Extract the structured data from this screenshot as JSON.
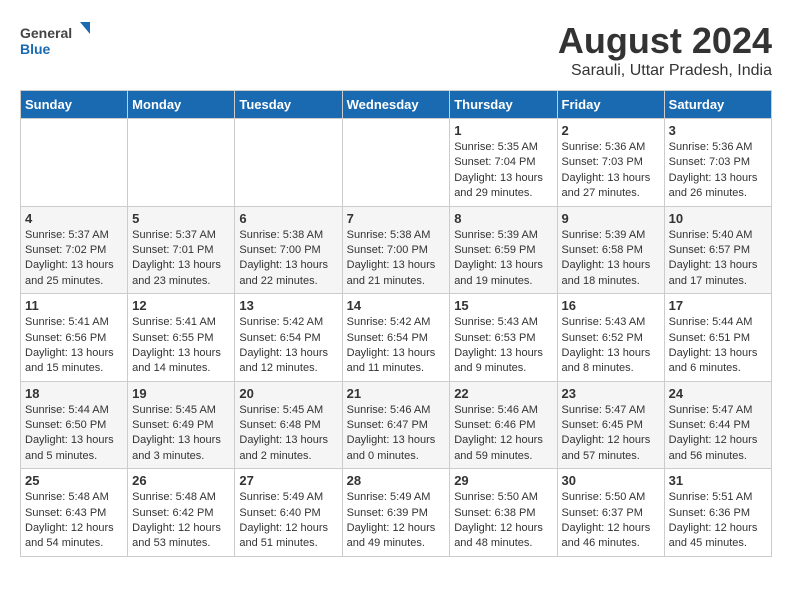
{
  "header": {
    "logo_general": "General",
    "logo_blue": "Blue",
    "month_year": "August 2024",
    "location": "Sarauli, Uttar Pradesh, India"
  },
  "days_of_week": [
    "Sunday",
    "Monday",
    "Tuesday",
    "Wednesday",
    "Thursday",
    "Friday",
    "Saturday"
  ],
  "weeks": [
    [
      {
        "day": "",
        "detail": ""
      },
      {
        "day": "",
        "detail": ""
      },
      {
        "day": "",
        "detail": ""
      },
      {
        "day": "",
        "detail": ""
      },
      {
        "day": "1",
        "detail": "Sunrise: 5:35 AM\nSunset: 7:04 PM\nDaylight: 13 hours\nand 29 minutes."
      },
      {
        "day": "2",
        "detail": "Sunrise: 5:36 AM\nSunset: 7:03 PM\nDaylight: 13 hours\nand 27 minutes."
      },
      {
        "day": "3",
        "detail": "Sunrise: 5:36 AM\nSunset: 7:03 PM\nDaylight: 13 hours\nand 26 minutes."
      }
    ],
    [
      {
        "day": "4",
        "detail": "Sunrise: 5:37 AM\nSunset: 7:02 PM\nDaylight: 13 hours\nand 25 minutes."
      },
      {
        "day": "5",
        "detail": "Sunrise: 5:37 AM\nSunset: 7:01 PM\nDaylight: 13 hours\nand 23 minutes."
      },
      {
        "day": "6",
        "detail": "Sunrise: 5:38 AM\nSunset: 7:00 PM\nDaylight: 13 hours\nand 22 minutes."
      },
      {
        "day": "7",
        "detail": "Sunrise: 5:38 AM\nSunset: 7:00 PM\nDaylight: 13 hours\nand 21 minutes."
      },
      {
        "day": "8",
        "detail": "Sunrise: 5:39 AM\nSunset: 6:59 PM\nDaylight: 13 hours\nand 19 minutes."
      },
      {
        "day": "9",
        "detail": "Sunrise: 5:39 AM\nSunset: 6:58 PM\nDaylight: 13 hours\nand 18 minutes."
      },
      {
        "day": "10",
        "detail": "Sunrise: 5:40 AM\nSunset: 6:57 PM\nDaylight: 13 hours\nand 17 minutes."
      }
    ],
    [
      {
        "day": "11",
        "detail": "Sunrise: 5:41 AM\nSunset: 6:56 PM\nDaylight: 13 hours\nand 15 minutes."
      },
      {
        "day": "12",
        "detail": "Sunrise: 5:41 AM\nSunset: 6:55 PM\nDaylight: 13 hours\nand 14 minutes."
      },
      {
        "day": "13",
        "detail": "Sunrise: 5:42 AM\nSunset: 6:54 PM\nDaylight: 13 hours\nand 12 minutes."
      },
      {
        "day": "14",
        "detail": "Sunrise: 5:42 AM\nSunset: 6:54 PM\nDaylight: 13 hours\nand 11 minutes."
      },
      {
        "day": "15",
        "detail": "Sunrise: 5:43 AM\nSunset: 6:53 PM\nDaylight: 13 hours\nand 9 minutes."
      },
      {
        "day": "16",
        "detail": "Sunrise: 5:43 AM\nSunset: 6:52 PM\nDaylight: 13 hours\nand 8 minutes."
      },
      {
        "day": "17",
        "detail": "Sunrise: 5:44 AM\nSunset: 6:51 PM\nDaylight: 13 hours\nand 6 minutes."
      }
    ],
    [
      {
        "day": "18",
        "detail": "Sunrise: 5:44 AM\nSunset: 6:50 PM\nDaylight: 13 hours\nand 5 minutes."
      },
      {
        "day": "19",
        "detail": "Sunrise: 5:45 AM\nSunset: 6:49 PM\nDaylight: 13 hours\nand 3 minutes."
      },
      {
        "day": "20",
        "detail": "Sunrise: 5:45 AM\nSunset: 6:48 PM\nDaylight: 13 hours\nand 2 minutes."
      },
      {
        "day": "21",
        "detail": "Sunrise: 5:46 AM\nSunset: 6:47 PM\nDaylight: 13 hours\nand 0 minutes."
      },
      {
        "day": "22",
        "detail": "Sunrise: 5:46 AM\nSunset: 6:46 PM\nDaylight: 12 hours\nand 59 minutes."
      },
      {
        "day": "23",
        "detail": "Sunrise: 5:47 AM\nSunset: 6:45 PM\nDaylight: 12 hours\nand 57 minutes."
      },
      {
        "day": "24",
        "detail": "Sunrise: 5:47 AM\nSunset: 6:44 PM\nDaylight: 12 hours\nand 56 minutes."
      }
    ],
    [
      {
        "day": "25",
        "detail": "Sunrise: 5:48 AM\nSunset: 6:43 PM\nDaylight: 12 hours\nand 54 minutes."
      },
      {
        "day": "26",
        "detail": "Sunrise: 5:48 AM\nSunset: 6:42 PM\nDaylight: 12 hours\nand 53 minutes."
      },
      {
        "day": "27",
        "detail": "Sunrise: 5:49 AM\nSunset: 6:40 PM\nDaylight: 12 hours\nand 51 minutes."
      },
      {
        "day": "28",
        "detail": "Sunrise: 5:49 AM\nSunset: 6:39 PM\nDaylight: 12 hours\nand 49 minutes."
      },
      {
        "day": "29",
        "detail": "Sunrise: 5:50 AM\nSunset: 6:38 PM\nDaylight: 12 hours\nand 48 minutes."
      },
      {
        "day": "30",
        "detail": "Sunrise: 5:50 AM\nSunset: 6:37 PM\nDaylight: 12 hours\nand 46 minutes."
      },
      {
        "day": "31",
        "detail": "Sunrise: 5:51 AM\nSunset: 6:36 PM\nDaylight: 12 hours\nand 45 minutes."
      }
    ]
  ]
}
